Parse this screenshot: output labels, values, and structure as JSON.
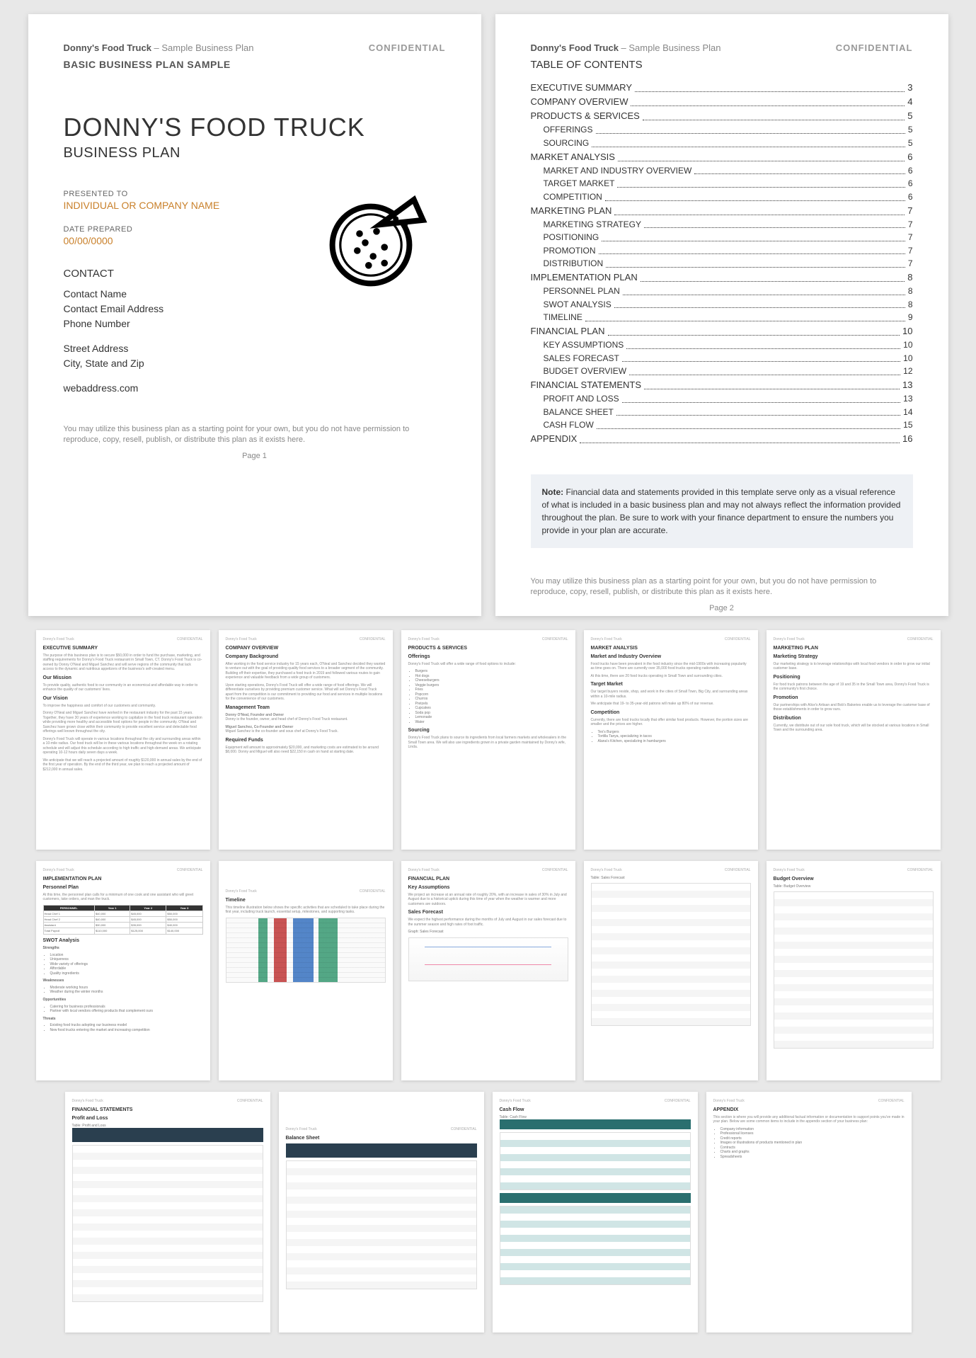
{
  "header": {
    "brand": "Donny's Food Truck",
    "suffix": " – Sample Business Plan",
    "confidential": "CONFIDENTIAL"
  },
  "page1": {
    "subheading": "BASIC BUSINESS PLAN SAMPLE",
    "title": "DONNY'S FOOD TRUCK",
    "subtitle": "BUSINESS PLAN",
    "presented_label": "PRESENTED TO",
    "presented_value": "INDIVIDUAL OR COMPANY NAME",
    "date_label": "DATE PREPARED",
    "date_value": "00/00/0000",
    "contact_heading": "CONTACT",
    "contact": {
      "name": "Contact Name",
      "email": "Contact Email Address",
      "phone": "Phone Number",
      "street": "Street Address",
      "city": "City, State and Zip",
      "web": "webaddress.com"
    },
    "disclaimer": "You may utilize this business plan as a starting point for your own, but you do not have permission to reproduce, copy, resell, publish, or distribute this plan as it exists here.",
    "pagenum": "Page 1"
  },
  "page2": {
    "toc_heading": "TABLE OF CONTENTS",
    "toc": [
      {
        "label": "EXECUTIVE SUMMARY",
        "page": "3",
        "sub": false
      },
      {
        "label": "COMPANY OVERVIEW",
        "page": "4",
        "sub": false
      },
      {
        "label": "PRODUCTS & SERVICES",
        "page": "5",
        "sub": false
      },
      {
        "label": "OFFERINGS",
        "page": "5",
        "sub": true
      },
      {
        "label": "SOURCING",
        "page": "5",
        "sub": true
      },
      {
        "label": "MARKET ANALYSIS",
        "page": "6",
        "sub": false
      },
      {
        "label": "MARKET AND INDUSTRY OVERVIEW",
        "page": "6",
        "sub": true
      },
      {
        "label": "TARGET MARKET",
        "page": "6",
        "sub": true
      },
      {
        "label": "COMPETITION",
        "page": "6",
        "sub": true
      },
      {
        "label": "MARKETING PLAN",
        "page": "7",
        "sub": false
      },
      {
        "label": "MARKETING STRATEGY",
        "page": "7",
        "sub": true
      },
      {
        "label": "POSITIONING",
        "page": "7",
        "sub": true
      },
      {
        "label": "PROMOTION",
        "page": "7",
        "sub": true
      },
      {
        "label": "DISTRIBUTION",
        "page": "7",
        "sub": true
      },
      {
        "label": "IMPLEMENTATION PLAN",
        "page": "8",
        "sub": false
      },
      {
        "label": "PERSONNEL PLAN",
        "page": "8",
        "sub": true
      },
      {
        "label": "SWOT ANALYSIS",
        "page": "8",
        "sub": true
      },
      {
        "label": "TIMELINE",
        "page": "9",
        "sub": true
      },
      {
        "label": "FINANCIAL PLAN",
        "page": "10",
        "sub": false
      },
      {
        "label": "KEY ASSUMPTIONS",
        "page": "10",
        "sub": true
      },
      {
        "label": "SALES FORECAST",
        "page": "10",
        "sub": true
      },
      {
        "label": "BUDGET OVERVIEW",
        "page": "12",
        "sub": true
      },
      {
        "label": "FINANCIAL STATEMENTS",
        "page": "13",
        "sub": false
      },
      {
        "label": "PROFIT AND LOSS",
        "page": "13",
        "sub": true
      },
      {
        "label": "BALANCE SHEET",
        "page": "14",
        "sub": true
      },
      {
        "label": "CASH FLOW",
        "page": "15",
        "sub": true
      },
      {
        "label": "APPENDIX",
        "page": "16",
        "sub": false
      }
    ],
    "note_label": "Note:",
    "note_body": " Financial data and statements provided in this template serve only as a visual reference of what is included in a basic business plan and may not always reflect the information provided throughout the plan. Be sure to work with your finance department to ensure the numbers you provide in your plan are accurate.",
    "disclaimer": "You may utilize this business plan as a starting point for your own, but you do not have permission to reproduce, copy, resell, publish, or distribute this plan as it exists here.",
    "pagenum": "Page 2"
  },
  "thumbs": {
    "p3": {
      "title": "EXECUTIVE SUMMARY",
      "mission_h": "Our Mission",
      "vision_h": "Our Vision"
    },
    "p4": {
      "title": "COMPANY OVERVIEW",
      "bg_h": "Company Background",
      "mgmt_h": "Management Team",
      "funds_h": "Required Funds"
    },
    "p5": {
      "title": "PRODUCTS & SERVICES",
      "off_h": "Offerings",
      "src_h": "Sourcing",
      "items": [
        "Burgers",
        "Hot dogs",
        "Cheeseburgers",
        "Veggie burgers",
        "Fries",
        "Popcorn",
        "Churros",
        "Pretzels",
        "Cupcakes",
        "Soda pop",
        "Lemonade",
        "Water"
      ]
    },
    "p6": {
      "title": "MARKET ANALYSIS",
      "mio_h": "Market and Industry Overview",
      "tm_h": "Target Market",
      "comp_h": "Competition"
    },
    "p7": {
      "title": "MARKETING PLAN",
      "ms_h": "Marketing Strategy",
      "pos_h": "Positioning",
      "promo_h": "Promotion",
      "dist_h": "Distribution"
    },
    "p8": {
      "title": "IMPLEMENTATION PLAN",
      "pp_h": "Personnel Plan",
      "swot_h": "SWOT Analysis",
      "s": "Strengths",
      "w": "Weaknesses",
      "o": "Opportunities",
      "t": "Threats"
    },
    "p9": {
      "title": "Timeline"
    },
    "p10": {
      "title": "FINANCIAL PLAN",
      "ka_h": "Key Assumptions",
      "sf_h": "Sales Forecast"
    },
    "p11": {
      "title": "Table: Sales Forecast"
    },
    "p12": {
      "title": "Budget Overview"
    },
    "p13": {
      "title": "FINANCIAL STATEMENTS",
      "pl_h": "Profit and Loss"
    },
    "p14": {
      "title": "Balance Sheet"
    },
    "p15": {
      "title": "Cash Flow"
    },
    "p16": {
      "title": "APPENDIX",
      "items": [
        "Company information",
        "Professional licenses",
        "Credit reports",
        "Images or illustrations of products mentioned in plan",
        "Contracts",
        "Charts and graphs",
        "Spreadsheets"
      ]
    }
  }
}
